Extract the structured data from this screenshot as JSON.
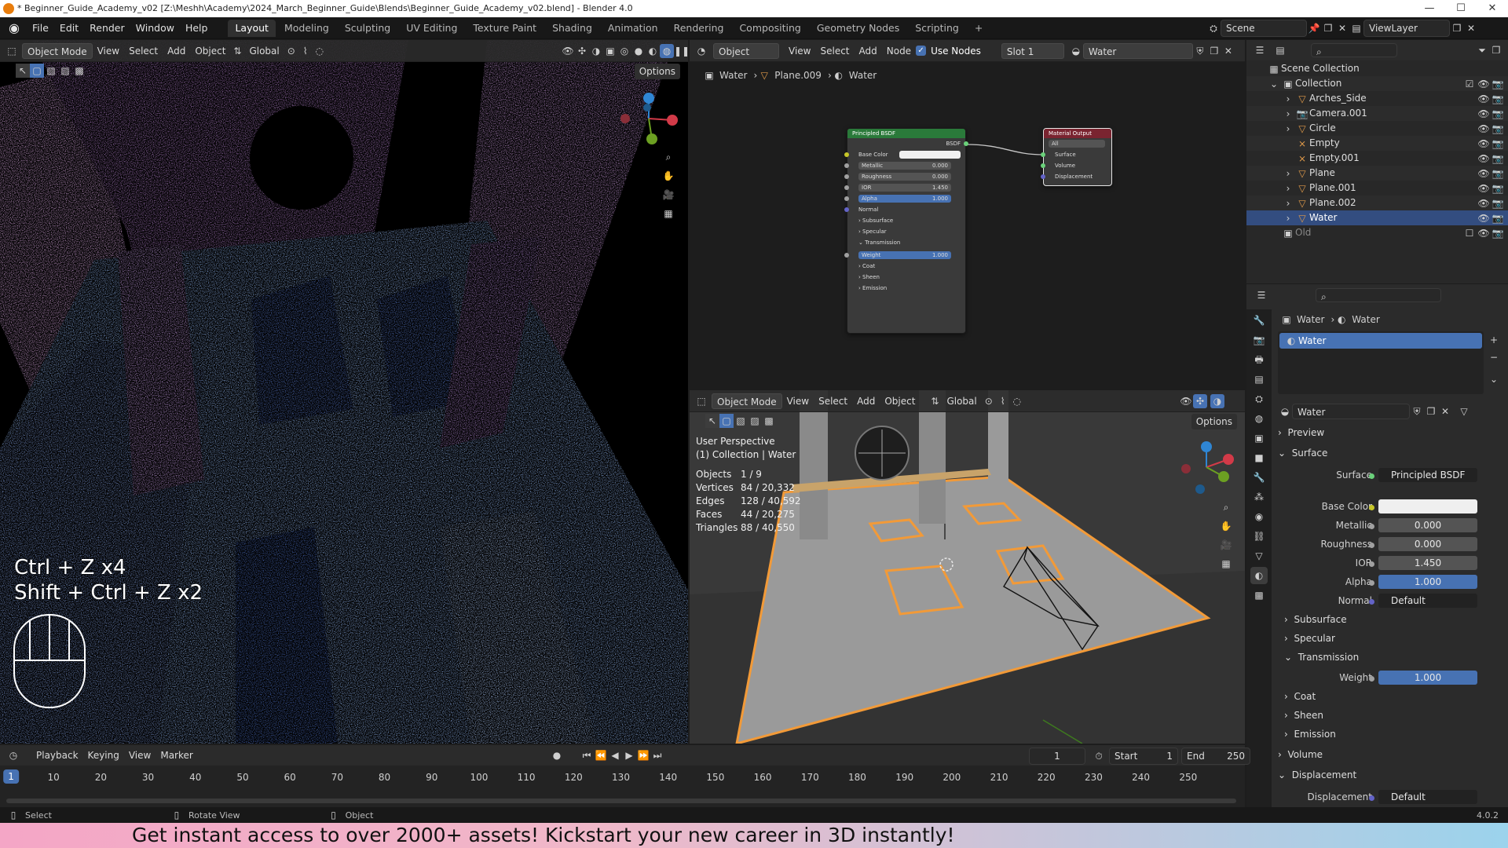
{
  "window": {
    "title": "* Beginner_Guide_Academy_v02 [Z:\\Meshh\\Academy\\2024_March_Beginner_Guide\\Blends\\Beginner_Guide_Academy_v02.blend] - Blender 4.0",
    "controls": [
      "—",
      "☐",
      "✕"
    ]
  },
  "menu": [
    "File",
    "Edit",
    "Render",
    "Window",
    "Help"
  ],
  "workspaces": [
    "Layout",
    "Modeling",
    "Sculpting",
    "UV Editing",
    "Texture Paint",
    "Shading",
    "Animation",
    "Rendering",
    "Compositing",
    "Geometry Nodes",
    "Scripting"
  ],
  "workspace_add": "+",
  "scene": "Scene",
  "view_layer": "ViewLayer",
  "left_viewport": {
    "mode": "Object Mode",
    "menus": [
      "View",
      "Select",
      "Add",
      "Object"
    ],
    "orientation": "Global",
    "options": "Options",
    "overlay_keys": [
      "Ctrl + Z x4",
      "Shift + Ctrl + Z x2"
    ]
  },
  "node_editor": {
    "object_dropdown": "Object",
    "menus": [
      "View",
      "Select",
      "Add",
      "Node"
    ],
    "use_nodes_label": "Use Nodes",
    "slot": "Slot 1",
    "material": "Water",
    "breadcrumb": [
      "Water",
      "Plane.009",
      "Water"
    ],
    "bsdf_node": {
      "title": "Principled BSDF",
      "output": "BSDF",
      "rows": [
        {
          "label": "Base Color",
          "value": ""
        },
        {
          "label": "Metallic",
          "value": "0.000"
        },
        {
          "label": "Roughness",
          "value": "0.000"
        },
        {
          "label": "IOR",
          "value": "1.450"
        },
        {
          "label": "Alpha",
          "value": "1.000"
        }
      ],
      "normal": "Normal",
      "sections": [
        "Subsurface",
        "Specular",
        "Transmission"
      ],
      "weight": {
        "label": "Weight",
        "value": "1.000"
      },
      "sections2": [
        "Coat",
        "Sheen",
        "Emission"
      ]
    },
    "output_node": {
      "title": "Material Output",
      "target": "All",
      "inputs": [
        "Surface",
        "Volume",
        "Displacement"
      ]
    }
  },
  "solid_viewport": {
    "mode": "Object Mode",
    "menus": [
      "View",
      "Select",
      "Add",
      "Object"
    ],
    "orientation": "Global",
    "options": "Options",
    "perspective": "User Perspective",
    "collection": "(1) Collection | Water",
    "stats": [
      {
        "label": "Objects",
        "value": "1 / 9"
      },
      {
        "label": "Vertices",
        "value": "84 / 20,332"
      },
      {
        "label": "Edges",
        "value": "128 / 40,592"
      },
      {
        "label": "Faces",
        "value": "44 / 20,275"
      },
      {
        "label": "Triangles",
        "value": "88 / 40,550"
      }
    ]
  },
  "outliner": {
    "root": "Scene Collection",
    "collection": "Collection",
    "items": [
      "Arches_Side",
      "Camera.001",
      "Circle",
      "Empty",
      "Empty.001",
      "Plane",
      "Plane.001",
      "Plane.002",
      "Water"
    ],
    "selected": "Water",
    "extra": "Old"
  },
  "properties": {
    "breadcrumb": [
      "Water",
      "Water"
    ],
    "slot_name": "Water",
    "material_name": "Water",
    "preview": "Preview",
    "surface_panel": "Surface",
    "surface": {
      "label": "Surface",
      "value": "Principled BSDF"
    },
    "base_color_label": "Base Color",
    "fields": [
      {
        "label": "Metallic",
        "value": "0.000"
      },
      {
        "label": "Roughness",
        "value": "0.000"
      },
      {
        "label": "IOR",
        "value": "1.450"
      },
      {
        "label": "Alpha",
        "value": "1.000"
      }
    ],
    "normal": {
      "label": "Normal",
      "value": "Default"
    },
    "subsections": [
      "Subsurface",
      "Specular",
      "Transmission"
    ],
    "weight": {
      "label": "Weight",
      "value": "1.000"
    },
    "subsections2": [
      "Coat",
      "Sheen",
      "Emission"
    ],
    "volume": "Volume",
    "displacement_panel": "Displacement",
    "displacement": {
      "label": "Displacement",
      "value": "Default"
    }
  },
  "timeline": {
    "menus": [
      "Playback",
      "Keying",
      "View",
      "Marker"
    ],
    "current_frame": "1",
    "start_label": "Start",
    "start": "1",
    "end_label": "End",
    "end": "250",
    "ticks": [
      "1",
      "10",
      "20",
      "30",
      "40",
      "50",
      "60",
      "70",
      "80",
      "90",
      "100",
      "110",
      "120",
      "130",
      "140",
      "150",
      "160",
      "170",
      "180",
      "190",
      "200",
      "210",
      "220",
      "230",
      "240",
      "250"
    ]
  },
  "status": {
    "left": "Select",
    "middle": "Rotate View",
    "right": "Object",
    "version": "4.0.2"
  },
  "banner": "Get instant access to over 2000+ assets! Kickstart your new career in 3D instantly!",
  "colors": {
    "accent": "#4772b3",
    "selection": "#334d80",
    "orange": "#e87d0d",
    "object_outline": "#f29a38"
  }
}
